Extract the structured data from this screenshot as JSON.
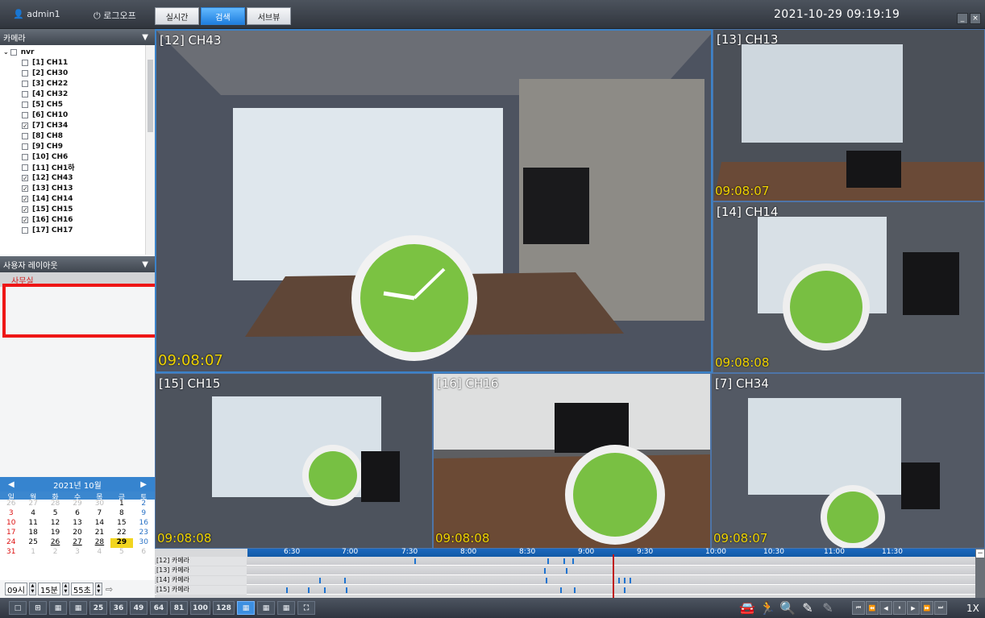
{
  "header": {
    "user": "admin1",
    "logout": "로그오프",
    "tabs": [
      {
        "label": "실시간"
      },
      {
        "label": "검색"
      },
      {
        "label": "서브뷰"
      }
    ],
    "datetime": "2021-10-29 09:19:19",
    "minimize": "_",
    "close": "×"
  },
  "sidebar": {
    "camera_title": "카메라",
    "tree_root": "nvr",
    "cameras": [
      {
        "label": "[1] CH11",
        "checked": false
      },
      {
        "label": "[2] CH30",
        "checked": false
      },
      {
        "label": "[3] CH22",
        "checked": false
      },
      {
        "label": "[4] CH32",
        "checked": false
      },
      {
        "label": "[5] CH5",
        "checked": false
      },
      {
        "label": "[6] CH10",
        "checked": false
      },
      {
        "label": "[7] CH34",
        "checked": true
      },
      {
        "label": "[8] CH8",
        "checked": false
      },
      {
        "label": "[9] CH9",
        "checked": false
      },
      {
        "label": "[10] CH6",
        "checked": false
      },
      {
        "label": "[11] CH1하",
        "checked": false
      },
      {
        "label": "[12] CH43",
        "checked": true
      },
      {
        "label": "[13] CH13",
        "checked": true
      },
      {
        "label": "[14] CH14",
        "checked": true
      },
      {
        "label": "[15] CH15",
        "checked": true
      },
      {
        "label": "[16] CH16",
        "checked": true
      },
      {
        "label": "[17] CH17",
        "checked": false
      }
    ],
    "layout_title": "사용자 레이아웃",
    "layout_item": "사무실",
    "calendar": {
      "title": "2021년 10월",
      "weekdays": [
        "일",
        "월",
        "화",
        "수",
        "목",
        "금",
        "토"
      ],
      "weeks": [
        [
          "26",
          "27",
          "28",
          "29",
          "30",
          "1",
          "2"
        ],
        [
          "3",
          "4",
          "5",
          "6",
          "7",
          "8",
          "9"
        ],
        [
          "10",
          "11",
          "12",
          "13",
          "14",
          "15",
          "16"
        ],
        [
          "17",
          "18",
          "19",
          "20",
          "21",
          "22",
          "23"
        ],
        [
          "24",
          "25",
          "26",
          "27",
          "28",
          "29",
          "30"
        ],
        [
          "31",
          "1",
          "2",
          "3",
          "4",
          "5",
          "6"
        ]
      ],
      "selected": "29"
    },
    "time": {
      "hour": "09시",
      "minute": "15분",
      "second": "55초"
    }
  },
  "video": {
    "cameras": [
      {
        "label": "[12] CH43",
        "time": "09:08:07"
      },
      {
        "label": "[13] CH13",
        "time": "09:08:07"
      },
      {
        "label": "[14] CH14",
        "time": "09:08:08"
      },
      {
        "label": "[15] CH15",
        "time": "09:08:08"
      },
      {
        "label": "[16] CH16",
        "time": "09:08:08"
      },
      {
        "label": "[7] CH34",
        "time": "09:08:07"
      }
    ]
  },
  "timeline": {
    "ticks": [
      "6:30",
      "7:00",
      "7:30",
      "8:00",
      "8:30",
      "9:00",
      "9:30",
      "10:00",
      "10:30",
      "11:00",
      "11:30"
    ],
    "rows": [
      {
        "label": "[12] 카메라"
      },
      {
        "label": "[13] 카메라"
      },
      {
        "label": "[14] 카메라"
      },
      {
        "label": "[15] 카메라"
      }
    ],
    "collapse": "−"
  },
  "bottom": {
    "layout_numbers": [
      "25",
      "36",
      "49",
      "64",
      "81",
      "100",
      "128"
    ],
    "speed": "1X"
  }
}
